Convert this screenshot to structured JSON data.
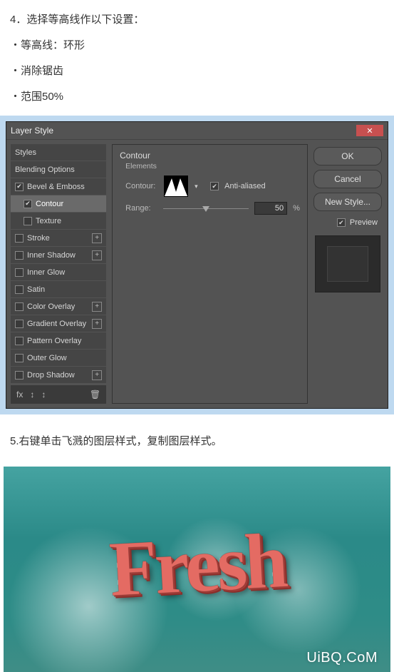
{
  "step4": {
    "title": "4．选择等高线作以下设置：",
    "bullets": [
      "・等高线：环形",
      "・消除锯齿",
      "・范围50%"
    ]
  },
  "layerStyle": {
    "windowTitle": "Layer Style",
    "left": {
      "styles": "Styles",
      "blendingOptions": "Blending Options",
      "bevelEmboss": "Bevel & Emboss",
      "contour": "Contour",
      "texture": "Texture",
      "stroke": "Stroke",
      "innerShadow": "Inner Shadow",
      "innerGlow": "Inner Glow",
      "satin": "Satin",
      "colorOverlay": "Color Overlay",
      "gradientOverlay": "Gradient Overlay",
      "patternOverlay": "Pattern Overlay",
      "outerGlow": "Outer Glow",
      "dropShadow": "Drop Shadow",
      "footerFx": "fx",
      "footerTrash": "🗑"
    },
    "center": {
      "title": "Contour",
      "subsection": "Elements",
      "contourLabel": "Contour:",
      "antiAliasedLabel": "Anti-aliased",
      "rangeLabel": "Range:",
      "rangeValue": "50",
      "rangeUnit": "%"
    },
    "right": {
      "ok": "OK",
      "cancel": "Cancel",
      "newStyle": "New Style...",
      "preview": "Preview"
    }
  },
  "step5": {
    "text": "5.右键单击飞溅的图层样式，复制图层样式。"
  },
  "resultArt": {
    "text": "Fresh",
    "watermark": "UiBQ.CoM"
  }
}
